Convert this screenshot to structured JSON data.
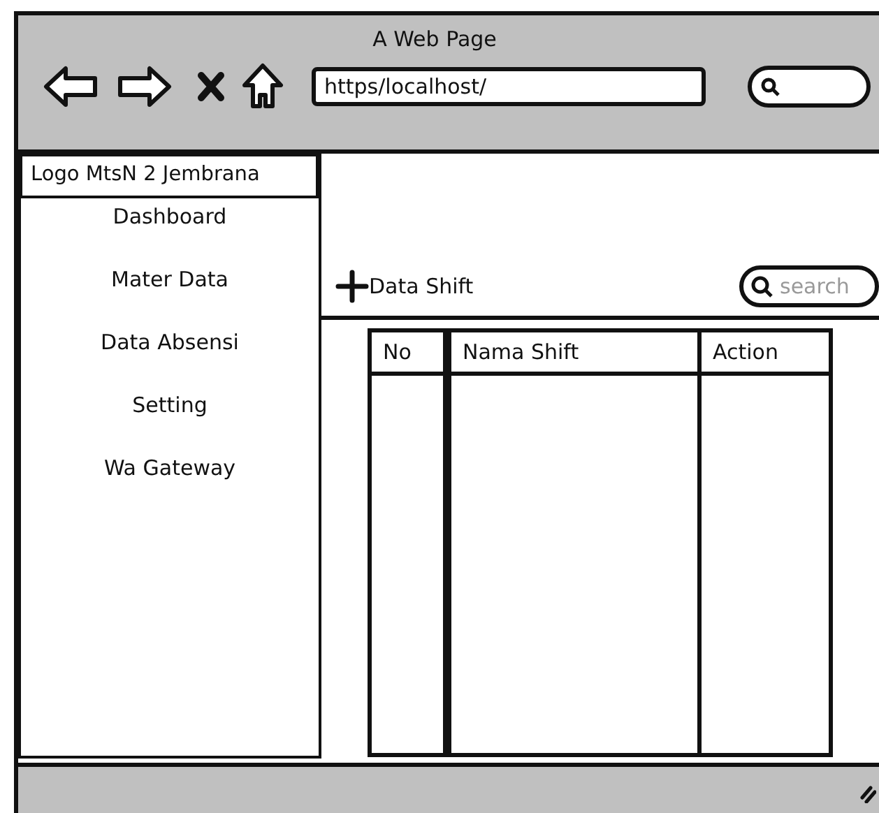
{
  "window": {
    "title": "A Web Page",
    "url": "https/localhost/"
  },
  "sidebar": {
    "logo": "Logo MtsN 2 Jembrana",
    "items": [
      {
        "label": "Dashboard"
      },
      {
        "label": "Mater Data"
      },
      {
        "label": "Data Absensi"
      },
      {
        "label": "Setting"
      },
      {
        "label": "Wa Gateway"
      }
    ]
  },
  "toolbar": {
    "add_label": "Data Shift",
    "search_placeholder": "search"
  },
  "table": {
    "columns": [
      "No",
      "Nama Shift",
      "Action"
    ]
  }
}
